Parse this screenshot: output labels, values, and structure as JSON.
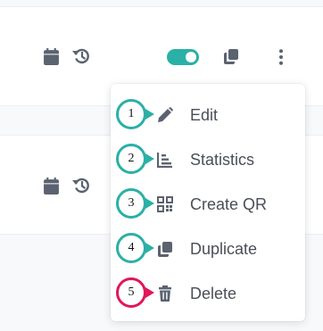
{
  "rows": [
    {
      "calendar_icon": "calendar-icon",
      "history_icon": "history-icon",
      "toggle_on": true,
      "duplicate_icon": "copy-icon",
      "more_icon": "more-vertical-icon"
    },
    {
      "calendar_icon": "calendar-icon",
      "history_icon": "history-icon"
    }
  ],
  "menu": {
    "items": [
      {
        "label": "Edit",
        "icon": "pencil-icon",
        "callout": "1"
      },
      {
        "label": "Statistics",
        "icon": "chart-icon",
        "callout": "2"
      },
      {
        "label": "Create QR",
        "icon": "qr-code-icon",
        "callout": "3"
      },
      {
        "label": "Duplicate",
        "icon": "copy-icon",
        "callout": "4"
      },
      {
        "label": "Delete",
        "icon": "trash-icon",
        "callout": "5"
      }
    ]
  },
  "colors": {
    "accent": "#2bb0a6",
    "icon": "#5b6270",
    "callout_teal": "#2bb0a6",
    "callout_red": "#e0175a",
    "text": "#4a4f57"
  }
}
